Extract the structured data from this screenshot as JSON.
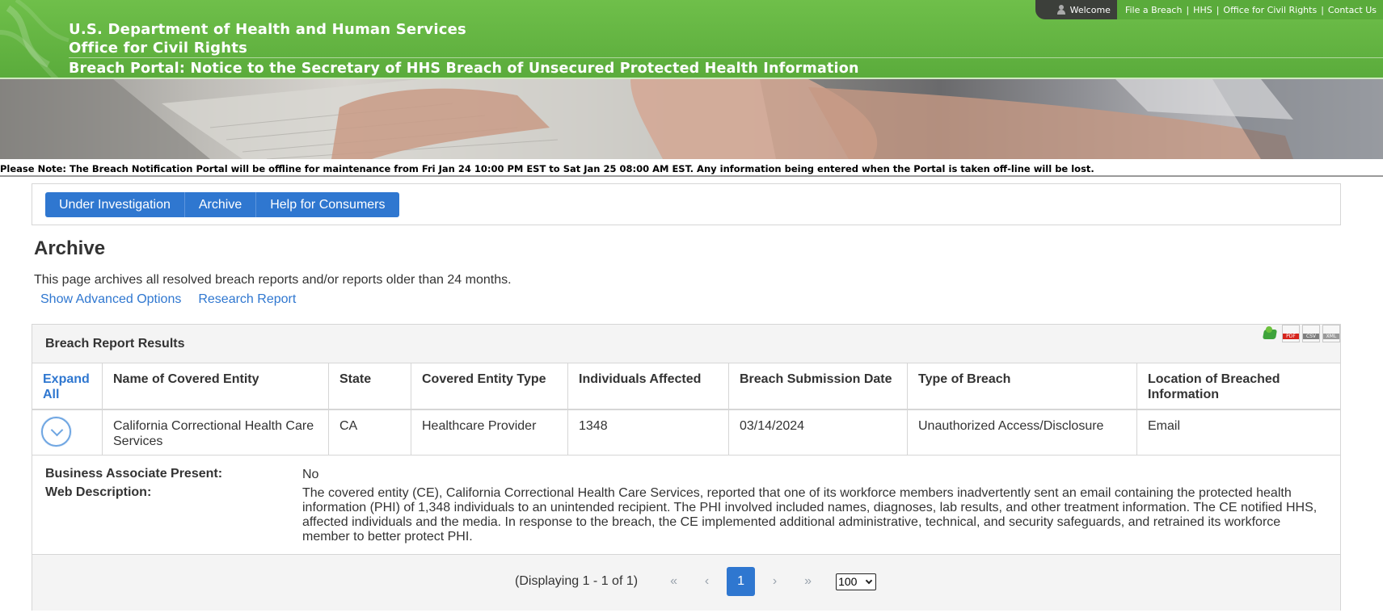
{
  "header": {
    "line1": "U.S. Department of Health and Human Services",
    "line2": "Office for Civil Rights",
    "line3": "Breach Portal: Notice to the Secretary of HHS Breach of Unsecured Protected Health Information"
  },
  "topnav": {
    "welcome": "Welcome",
    "links": [
      "File a Breach",
      "HHS",
      "Office for Civil Rights",
      "Contact Us"
    ]
  },
  "notice": "Please Note: The Breach Notification Portal will be offline for maintenance from Fri Jan 24 10:00 PM EST to Sat Jan 25 08:00 AM EST. Any information being entered when the Portal is taken off-line will be lost.",
  "tabs": [
    "Under Investigation",
    "Archive",
    "Help for Consumers"
  ],
  "page": {
    "title": "Archive",
    "description": "This page archives all resolved breach reports and/or reports older than 24 months.",
    "links": [
      "Show Advanced Options",
      "Research Report"
    ]
  },
  "results": {
    "title": "Breach Report Results",
    "export_icons": [
      "excel-icon",
      "pdf-icon",
      "csv-icon",
      "xml-icon"
    ],
    "export_labels": [
      "PDF",
      "CSV",
      "XML"
    ],
    "columns": [
      "Expand All",
      "Name of Covered Entity",
      "State",
      "Covered Entity Type",
      "Individuals Affected",
      "Breach Submission Date",
      "Type of Breach",
      "Location of Breached Information"
    ],
    "rows": [
      {
        "name": "California Correctional Health Care Services",
        "state": "CA",
        "entity_type": "Healthcare Provider",
        "individuals": "1348",
        "date": "03/14/2024",
        "breach_type": "Unauthorized Access/Disclosure",
        "location": "Email"
      }
    ],
    "detail": {
      "ba_label": "Business Associate Present:",
      "ba_value": "No",
      "desc_label": "Web Description:",
      "desc_value": "The covered entity (CE), California Correctional Health Care Services, reported that one of its workforce members inadvertently sent an email containing the protected health information (PHI) of 1,348 individuals to an unintended recipient. The PHI involved included names, diagnoses, lab results, and other treatment information. The CE notified HHS, affected individuals and the media. In response to the breach, the CE implemented additional administrative, technical, and security safeguards, and retrained its workforce member to better protect PHI."
    },
    "pager": {
      "status": "(Displaying 1 - 1 of 1)",
      "first": "«",
      "prev": "‹",
      "current": "1",
      "next": "›",
      "last": "»",
      "page_size": "100"
    }
  },
  "colors": {
    "header_green": "#5aab3b",
    "accent_blue": "#2f77d0",
    "panel_gray": "#f4f4f4"
  }
}
